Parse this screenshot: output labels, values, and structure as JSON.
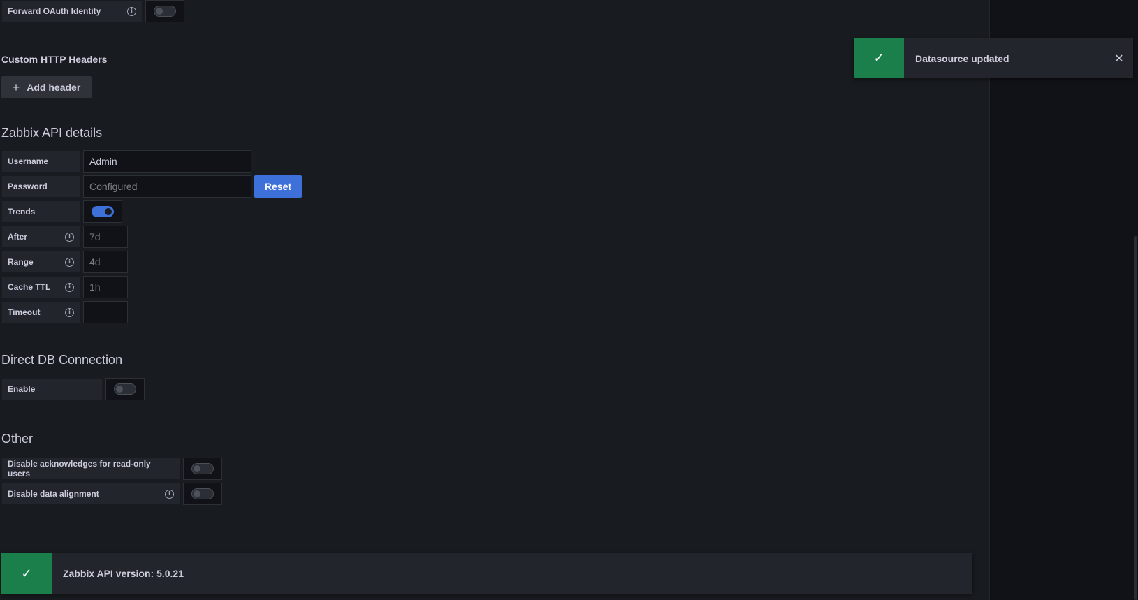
{
  "oauth": {
    "forward_label": "Forward OAuth Identity",
    "forward_enabled": false
  },
  "custom_headers": {
    "title": "Custom HTTP Headers",
    "add_label": "Add header"
  },
  "zabbix_api": {
    "title": "Zabbix API details",
    "username_label": "Username",
    "username_value": "Admin",
    "password_label": "Password",
    "password_value": "Configured",
    "reset_label": "Reset",
    "trends_label": "Trends",
    "trends_enabled": true,
    "after_label": "After",
    "after_placeholder": "7d",
    "range_label": "Range",
    "range_placeholder": "4d",
    "cache_ttl_label": "Cache TTL",
    "cache_ttl_placeholder": "1h",
    "timeout_label": "Timeout",
    "timeout_value": ""
  },
  "direct_db": {
    "title": "Direct DB Connection",
    "enable_label": "Enable",
    "enable_enabled": false
  },
  "other": {
    "title": "Other",
    "disable_acks_label": "Disable acknowledges for read-only users",
    "disable_acks_enabled": false,
    "disable_alignment_label": "Disable data alignment",
    "disable_alignment_enabled": false
  },
  "test_result": {
    "message": "Zabbix API version: 5.0.21"
  },
  "toast": {
    "message": "Datasource updated"
  },
  "icons": {
    "check": "check-icon",
    "close": "close-icon",
    "info": "info-icon",
    "plus": "plus-icon"
  },
  "colors": {
    "success": "#1a7f4b",
    "primary": "#3d71d9",
    "background": "#181b1f"
  }
}
